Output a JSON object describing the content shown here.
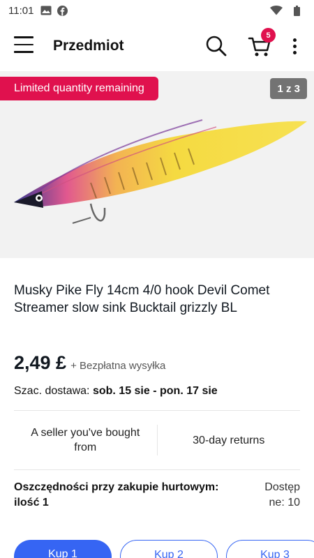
{
  "status_bar": {
    "time": "11:01"
  },
  "app_bar": {
    "title": "Przedmiot",
    "cart_count": "5"
  },
  "hero": {
    "promo_badge": "Limited quantity remaining",
    "page_counter": "1 z 3"
  },
  "item": {
    "title": "Musky Pike Fly 14cm 4/0 hook Devil Comet Streamer slow sink Bucktail grizzly BL",
    "price": "2,49 £",
    "shipping": "+ Bezpłatna wysyłka",
    "delivery_label": "Szac. dostawa:",
    "delivery_dates": "sob. 15 sie - pon. 17 sie"
  },
  "trust": {
    "seller": "A seller you've bought from",
    "returns": "30-day returns"
  },
  "bulk": {
    "title": "Oszczędności przy zakupie hurtowym: ilość 1",
    "availability": "Dostępne: 10"
  },
  "buy_buttons": [
    {
      "label": "Kup 1"
    },
    {
      "label": "Kup 2"
    },
    {
      "label": "Kup 3"
    }
  ],
  "colors": {
    "accent": "#3665f3",
    "badge": "#e0114e"
  },
  "icons": [
    "image-icon",
    "facebook-icon",
    "wifi-icon",
    "battery-icon",
    "menu-icon",
    "search-icon",
    "cart-icon",
    "more-vert-icon"
  ]
}
